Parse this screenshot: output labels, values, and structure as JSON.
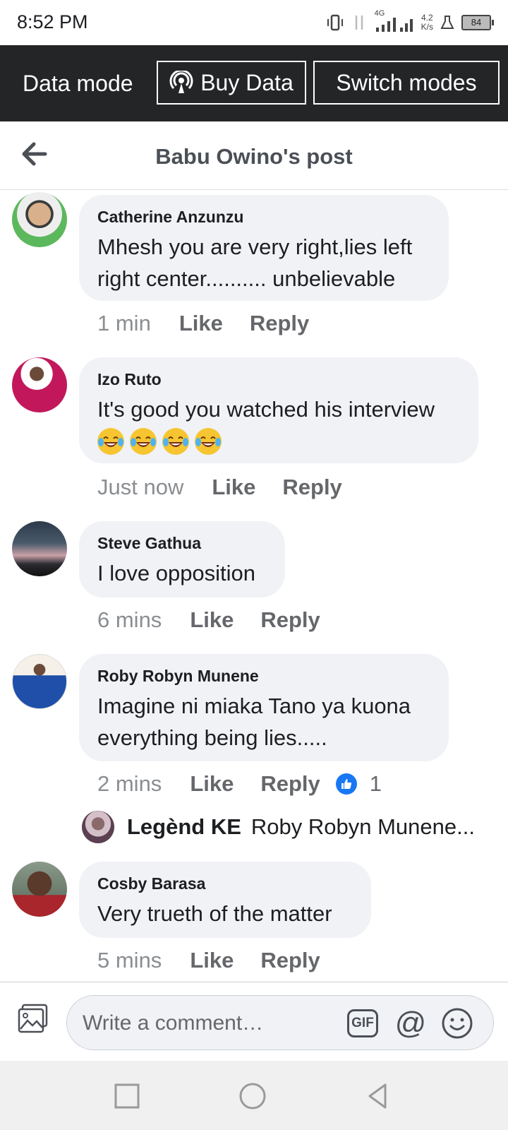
{
  "status_bar": {
    "time": "8:52 PM",
    "network": "4G",
    "speed_value": "4.2",
    "speed_unit": "K/s",
    "battery": "84"
  },
  "data_mode_bar": {
    "label": "Data mode",
    "buy_data_label": "Buy Data",
    "switch_modes_label": "Switch modes"
  },
  "header": {
    "title": "Babu Owino's post"
  },
  "comments": [
    {
      "name": "Catherine Anzunzu",
      "text_lines": [
        "Mhesh you are very right,lies left",
        "right center.......... unbelievable"
      ],
      "time": "1 min",
      "like_label": "Like",
      "reply_label": "Reply"
    },
    {
      "name": "Izo Ruto",
      "text_lines": [
        "It's good you watched his interview"
      ],
      "emoji_count": 4,
      "time": "Just now",
      "like_label": "Like",
      "reply_label": "Reply"
    },
    {
      "name": "Steve Gathua",
      "text_lines": [
        "I love opposition"
      ],
      "time": "6 mins",
      "like_label": "Like",
      "reply_label": "Reply"
    },
    {
      "name": "Roby Robyn Munene",
      "text_lines": [
        "Imagine ni miaka Tano ya kuona",
        "everything being lies....."
      ],
      "time": "2 mins",
      "like_label": "Like",
      "reply_label": "Reply",
      "reaction_count": "1",
      "reply_preview": {
        "name": "Legènd KE",
        "text": "Roby Robyn Munene..."
      }
    },
    {
      "name": "Cosby Barasa",
      "text_lines": [
        "Very trueth of the matter"
      ],
      "time": "5 mins",
      "like_label": "Like",
      "reply_label": "Reply"
    }
  ],
  "composer": {
    "placeholder": "Write a comment…",
    "gif_label": "GIF",
    "mention_label": "@"
  },
  "colors": {
    "data_bar_bg": "#242527",
    "bubble_bg": "#f0f2f5",
    "like_blue": "#1877f2"
  }
}
